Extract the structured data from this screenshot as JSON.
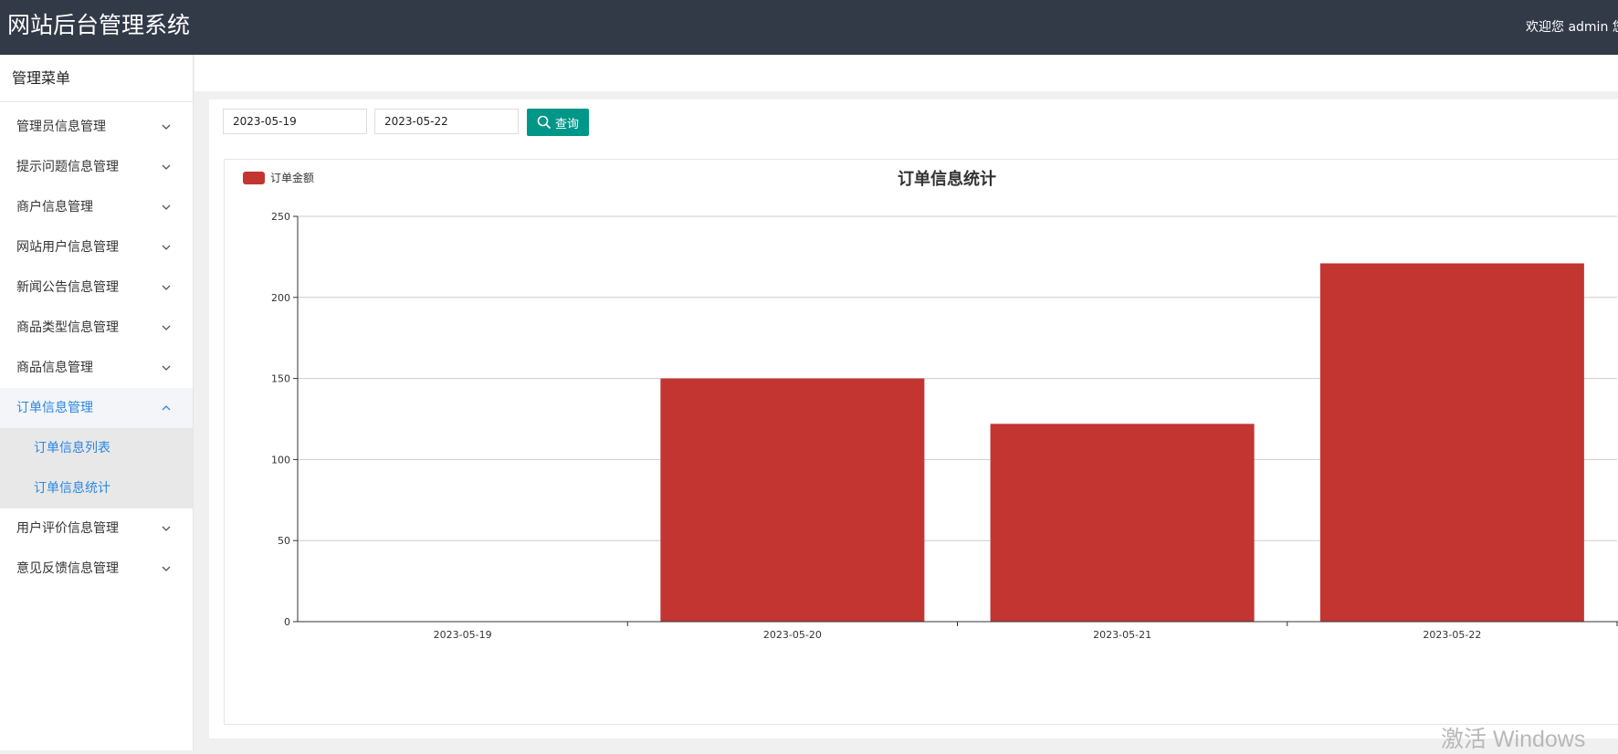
{
  "header": {
    "title": "网站后台管理系统",
    "welcome": "欢迎您 admin 您"
  },
  "sidebar": {
    "title": "管理菜单",
    "items": [
      {
        "label": "管理员信息管理"
      },
      {
        "label": "提示问题信息管理"
      },
      {
        "label": "商户信息管理"
      },
      {
        "label": "网站用户信息管理"
      },
      {
        "label": "新闻公告信息管理"
      },
      {
        "label": "商品类型信息管理"
      },
      {
        "label": "商品信息管理"
      },
      {
        "label": "订单信息管理",
        "expanded": true,
        "children": [
          {
            "label": "订单信息列表"
          },
          {
            "label": "订单信息统计"
          }
        ]
      },
      {
        "label": "用户评价信息管理"
      },
      {
        "label": "意见反馈信息管理"
      }
    ]
  },
  "filters": {
    "start_date": "2023-05-19",
    "end_date": "2023-05-22",
    "search_label": "查询"
  },
  "colors": {
    "header_bg": "#323a48",
    "accent": "#2c86e3",
    "search_button": "#009688",
    "bar": "#c23531"
  },
  "watermark": "激活 Windows",
  "chart_data": {
    "type": "bar",
    "title": "订单信息统计",
    "categories": [
      "2023-05-19",
      "2023-05-20",
      "2023-05-21",
      "2023-05-22"
    ],
    "series": [
      {
        "name": "订单金额",
        "values": [
          0,
          150,
          122,
          221
        ]
      }
    ],
    "yticks": [
      0,
      50,
      100,
      150,
      200,
      250
    ],
    "ylim": [
      0,
      250
    ],
    "grid": true,
    "legend": "top-left"
  }
}
